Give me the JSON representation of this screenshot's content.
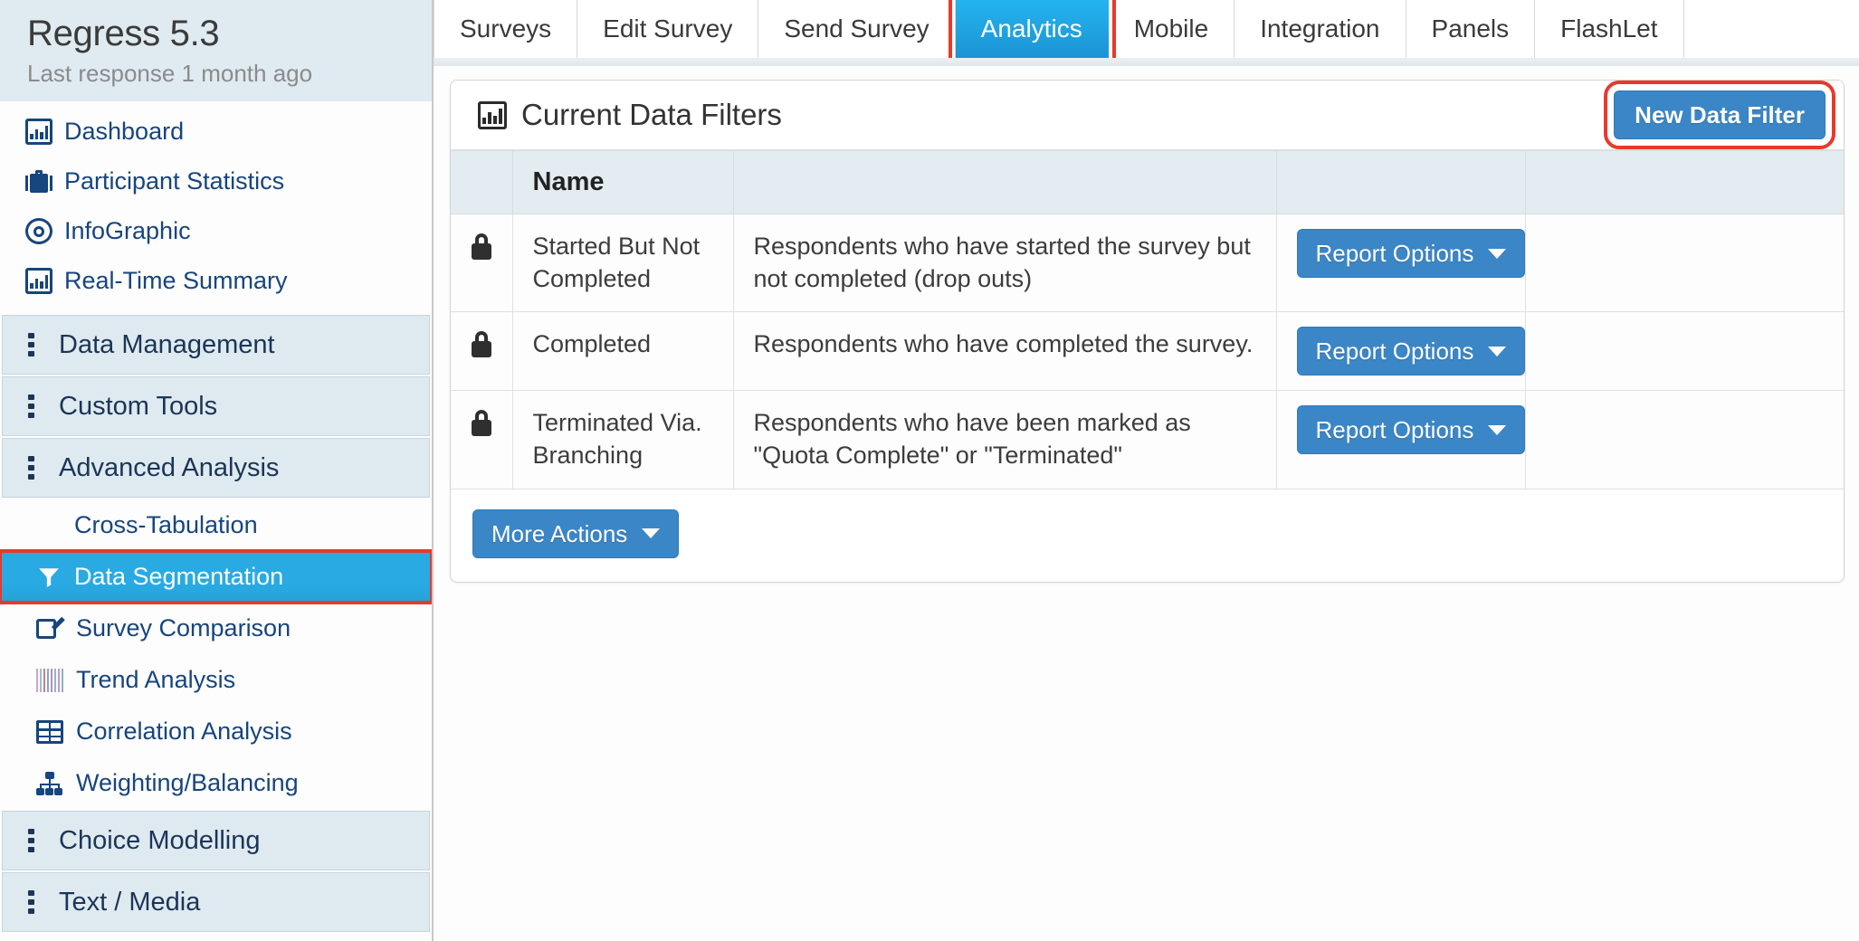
{
  "sidebar": {
    "title": "Regress 5.3",
    "subtitle": "Last response 1 month ago",
    "links": [
      {
        "label": "Dashboard",
        "icon": "bar-chart-icon"
      },
      {
        "label": "Participant Statistics",
        "icon": "briefcase-icon"
      },
      {
        "label": "InfoGraphic",
        "icon": "target-icon"
      },
      {
        "label": "Real-Time Summary",
        "icon": "bar-chart-icon"
      }
    ],
    "sections": [
      {
        "label": "Data Management",
        "icon": "list-icon"
      },
      {
        "label": "Custom Tools",
        "icon": "list-icon"
      },
      {
        "label": "Advanced Analysis",
        "icon": "list-icon"
      }
    ],
    "advanced_items": [
      {
        "label": "Cross-Tabulation",
        "icon": "grid-icon",
        "active": false
      },
      {
        "label": "Data Segmentation",
        "icon": "funnel-icon",
        "active": true
      },
      {
        "label": "Survey Comparison",
        "icon": "edit-icon",
        "active": false
      },
      {
        "label": "Trend Analysis",
        "icon": "trend-bars-icon",
        "active": false
      },
      {
        "label": "Correlation Analysis",
        "icon": "table-icon",
        "active": false
      },
      {
        "label": "Weighting/Balancing",
        "icon": "org-chart-icon",
        "active": false
      }
    ],
    "bottom_sections": [
      {
        "label": "Choice Modelling",
        "icon": "list-icon"
      },
      {
        "label": "Text / Media",
        "icon": "list-icon"
      }
    ],
    "active_item": "Data Segmentation",
    "highlight_color": "#e8392b",
    "active_bg": "#29aae2"
  },
  "tabs": [
    {
      "label": "Surveys",
      "active": false
    },
    {
      "label": "Edit Survey",
      "active": false
    },
    {
      "label": "Send Survey",
      "active": false
    },
    {
      "label": "Analytics",
      "active": true
    },
    {
      "label": "Mobile",
      "active": false
    },
    {
      "label": "Integration",
      "active": false
    },
    {
      "label": "Panels",
      "active": false
    },
    {
      "label": "FlashLet",
      "active": false
    }
  ],
  "panel": {
    "title": "Current Data Filters",
    "title_icon": "bar-chart-icon",
    "new_filter_button": "New Data Filter",
    "more_actions_button": "More Actions",
    "columns": [
      "",
      "Name",
      "",
      "",
      ""
    ],
    "rows": [
      {
        "locked": true,
        "lock_icon": "lock-icon",
        "name": "Started But Not Completed",
        "description": "Respondents who have started the survey but not completed (drop outs)",
        "action": "Report Options"
      },
      {
        "locked": true,
        "lock_icon": "lock-icon",
        "name": "Completed",
        "description": "Respondents who have completed the survey.",
        "action": "Report Options"
      },
      {
        "locked": true,
        "lock_icon": "lock-icon",
        "name": "Terminated Via. Branching",
        "description": "Respondents who have been marked as \"Quota Complete\" or \"Terminated\"",
        "action": "Report Options"
      }
    ]
  },
  "colors": {
    "accent_blue": "#3b86c6",
    "tab_active": "#1c93d4",
    "highlight_red": "#e8392b",
    "magenta_block": "#ff00ff"
  }
}
